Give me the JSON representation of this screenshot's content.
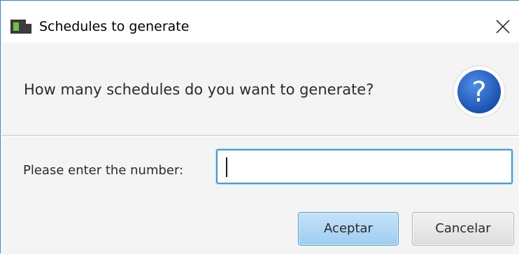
{
  "window": {
    "title": "Schedules to generate",
    "icons": {
      "app": "java-app-icon",
      "close": "close-icon"
    }
  },
  "header": {
    "text": "How many schedules do you want to generate?",
    "icon": "question-icon",
    "icon_glyph": "?"
  },
  "form": {
    "label": "Please enter the number:",
    "input_value": "",
    "input_placeholder": ""
  },
  "buttons": {
    "accept_label": "Aceptar",
    "cancel_label": "Cancelar"
  },
  "colors": {
    "accent": "#3d9fe0",
    "question_icon_fill": "#1f5fbe",
    "dialog_bg": "#f4f4f4"
  }
}
